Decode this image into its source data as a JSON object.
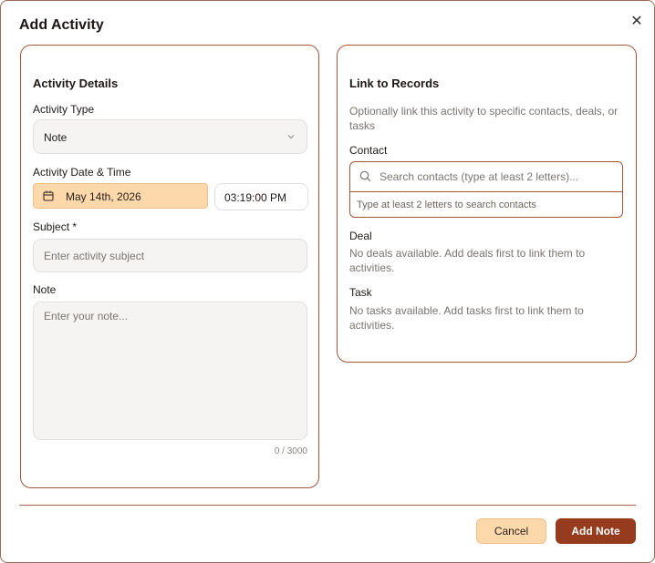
{
  "dialog": {
    "title": "Add Activity",
    "close_icon": "close-icon"
  },
  "details": {
    "section_title": "Activity Details",
    "type_label": "Activity Type",
    "type_value": "Note",
    "datetime_label": "Activity Date & Time",
    "date_value": "May 14th, 2026",
    "time_value": "03:19:00 PM",
    "subject_label": "Subject *",
    "subject_placeholder": "Enter activity subject",
    "note_label": "Note",
    "note_placeholder": "Enter your note...",
    "note_counter": "0 / 3000"
  },
  "link": {
    "section_title": "Link to Records",
    "description": "Optionally link this activity to specific contacts, deals, or tasks",
    "contact_label": "Contact",
    "contact_placeholder": "Search contacts (type at least 2 letters)...",
    "contact_hint": "Type at least 2 letters to search contacts",
    "deal_label": "Deal",
    "deal_empty": "No deals available. Add deals first to link them to activities.",
    "task_label": "Task",
    "task_empty": "No tasks available. Add tasks first to link them to activities."
  },
  "footer": {
    "cancel_label": "Cancel",
    "submit_label": "Add Note"
  },
  "colors": {
    "accent": "#963b1e",
    "accent_light": "#fdd8ab",
    "border": "#a2543a"
  }
}
